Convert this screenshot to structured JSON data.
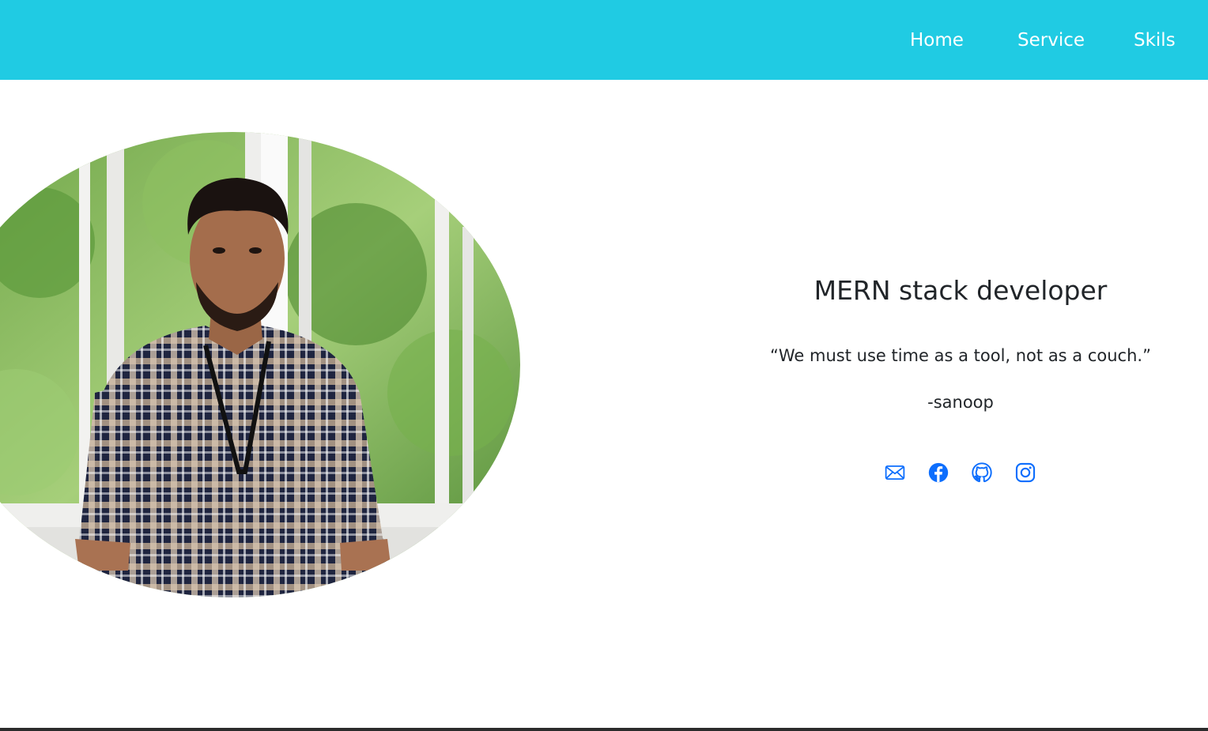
{
  "nav": {
    "links": [
      "Home",
      "Service",
      "Skils"
    ]
  },
  "hero": {
    "title": "MERN stack developer",
    "quote": "“We must use time as a tool, not as a couch.”",
    "author": "-sanoop"
  },
  "social": {
    "icons": [
      "mail-icon",
      "facebook-icon",
      "github-icon",
      "instagram-icon"
    ]
  },
  "colors": {
    "navbar": "#20cbe3",
    "text": "#212529",
    "link": "#0d6efd",
    "background": "#ffffff"
  }
}
